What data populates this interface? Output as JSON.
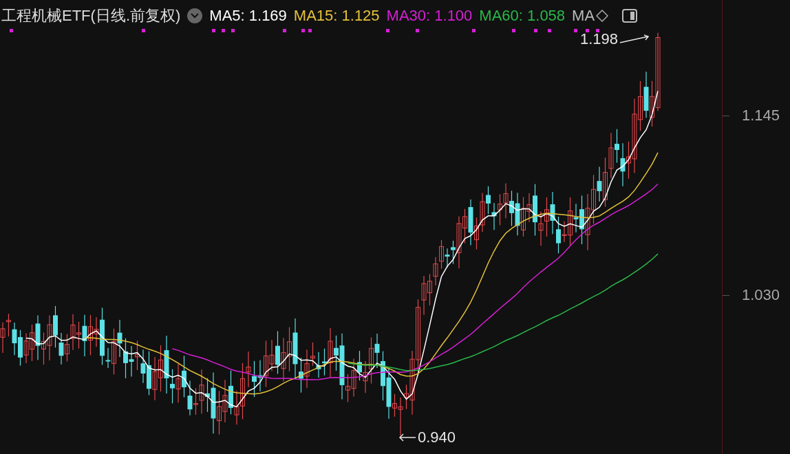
{
  "header": {
    "title": "工程机械ETF(日线.前复权)",
    "indicators": [
      {
        "label": "MA5: 1.169",
        "color": "#ffffff"
      },
      {
        "label": "MA15: 1.125",
        "color": "#e6c23a"
      },
      {
        "label": "MA30: 1.100",
        "color": "#d61fd6"
      },
      {
        "label": "MA60: 1.058",
        "color": "#2ab84a"
      }
    ],
    "overflow": "MA"
  },
  "price_axis": {
    "ticks": [
      "1.145",
      "1.030"
    ]
  },
  "annotations": {
    "high": "1.198",
    "low": "0.940"
  }
}
